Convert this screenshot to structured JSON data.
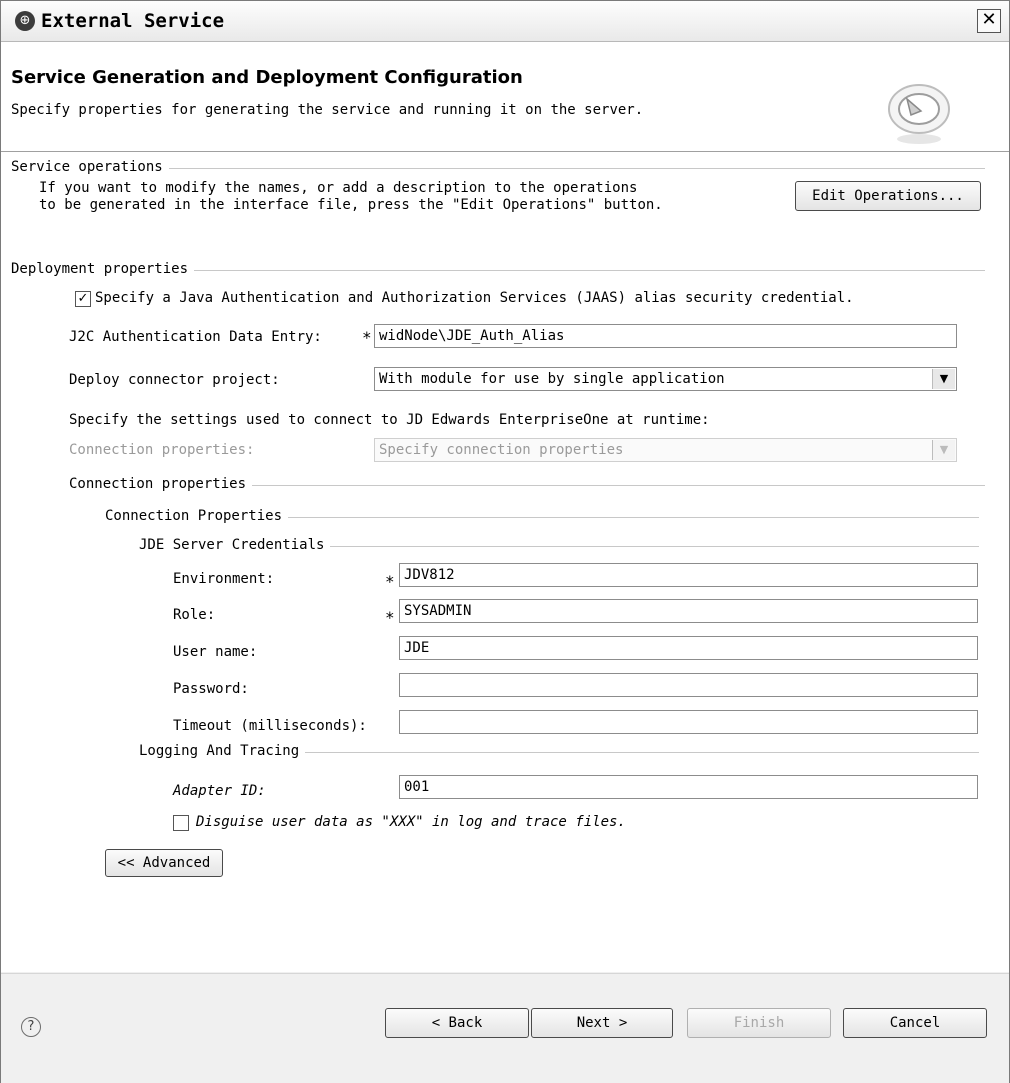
{
  "window": {
    "title": "External Service",
    "close_label": "✕",
    "icon": "service-icon"
  },
  "header": {
    "title": "Service Generation and Deployment Configuration",
    "description": "Specify properties for generating the service and running it on the server."
  },
  "service_operations": {
    "group_label": "Service operations",
    "line1": "If you want to modify the names, or add a description to the operations",
    "line2": "to be generated in the interface file, press the \"Edit Operations\" button.",
    "edit_button": "Edit Operations..."
  },
  "deployment": {
    "group_label": "Deployment properties",
    "jaas_checkbox_label": "Specify a Java Authentication and Authorization Services (JAAS) alias security credential.",
    "jaas_checked": true,
    "j2c_label": "J2C Authentication Data Entry:",
    "required_mark": "*",
    "j2c_value": "widNode\\JDE_Auth_Alias",
    "deploy_label": "Deploy connector project:",
    "deploy_value": "With module for use by single application",
    "settings_text": "Specify the settings used to connect to JD Edwards EnterpriseOne at runtime:",
    "conn_label_disabled": "Connection properties:",
    "conn_value_disabled": "Specify connection properties"
  },
  "connection": {
    "group_label": "Connection properties",
    "sub_group_label": "Connection Properties",
    "credentials_group_label": "JDE Server Credentials",
    "environment_label": "Environment:",
    "environment_value": "JDV812",
    "role_label": "Role:",
    "role_value": "SYSADMIN",
    "username_label": "User name:",
    "username_value": "JDE",
    "password_label": "Password:",
    "password_value": "",
    "timeout_label": "Timeout (milliseconds):",
    "timeout_value": "",
    "logging_group_label": "Logging And Tracing",
    "adapter_label": "Adapter ID:",
    "adapter_value": "001",
    "disguise_label": "Disguise user data as \"XXX\" in log and trace files.",
    "disguise_checked": false,
    "advanced_button": "<< Advanced"
  },
  "footer": {
    "help_icon": "question-icon",
    "back_button": "< Back",
    "next_button": "Next >",
    "finish_button": "Finish",
    "cancel_button": "Cancel"
  }
}
